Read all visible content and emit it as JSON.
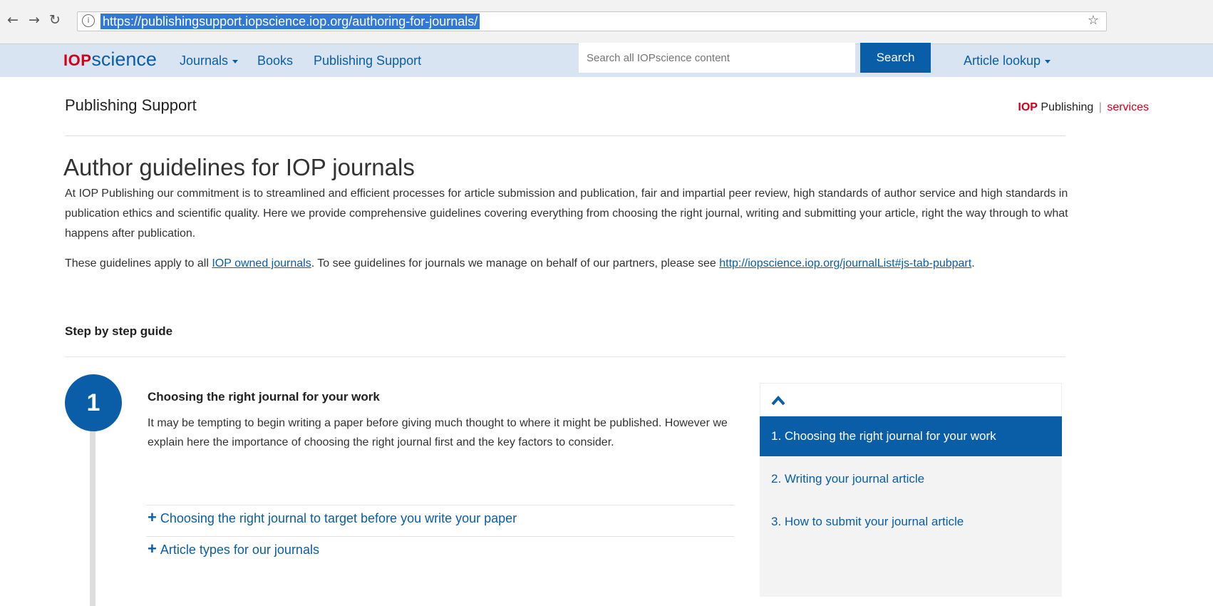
{
  "browser": {
    "url": "https://publishingsupport.iopscience.iop.org/authoring-for-journals/",
    "back_icon": "arrow-left-icon",
    "forward_icon": "arrow-right-icon",
    "reload_icon": "reload-icon",
    "info_icon": "info-icon",
    "star_icon": "star-icon"
  },
  "site_header": {
    "logo_iop": "IOP",
    "logo_science": "science",
    "nav": [
      "Journals",
      "Books",
      "Publishing Support"
    ],
    "search_placeholder": "Search all IOPscience content",
    "search_label": "Search",
    "article_lookup": "Article lookup"
  },
  "page": {
    "section_title": "Publishing Support",
    "brand_iop": "IOP",
    "brand_publishing": "Publishing",
    "brand_sep": "|",
    "brand_services": "services",
    "title": "Author guidelines for IOP journals",
    "intro": "At IOP Publishing our commitment is to streamlined and efficient processes for article submission and publication, fair and impartial peer review, high standards of author service and high standards in publication ethics and scientific quality. Here we provide comprehensive guidelines covering everything from choosing the right journal, writing and submitting your article, right the way through to what happens after publication.",
    "guidelines_pre": "These guidelines apply to all ",
    "guidelines_link1": "IOP owned journals",
    "guidelines_mid": ". To see guidelines for journals we manage on behalf of our partners, please see ",
    "guidelines_link2": "http://iopscience.iop.org/journalList#js-tab-pubpart",
    "guidelines_post": ".",
    "step_heading": "Step by step guide"
  },
  "step": {
    "number": "1",
    "title": "Choosing the right journal for your work",
    "description": "It may be tempting to begin writing a paper before giving much thought to where it might be published. However we explain here the importance of choosing the right journal first and the key factors to consider.",
    "accordion": [
      "Choosing the right journal to target before you write your paper",
      "Article types for our journals"
    ]
  },
  "sidebar": {
    "collapse_icon": "chevron-up-icon",
    "items": [
      "1. Choosing the right journal for your work",
      "2. Writing your journal article",
      "3. How to submit your journal article"
    ]
  },
  "colors": {
    "primary": "#0a5ea8",
    "brand_red": "#d0021b",
    "header_bg": "#d8e4f1"
  }
}
